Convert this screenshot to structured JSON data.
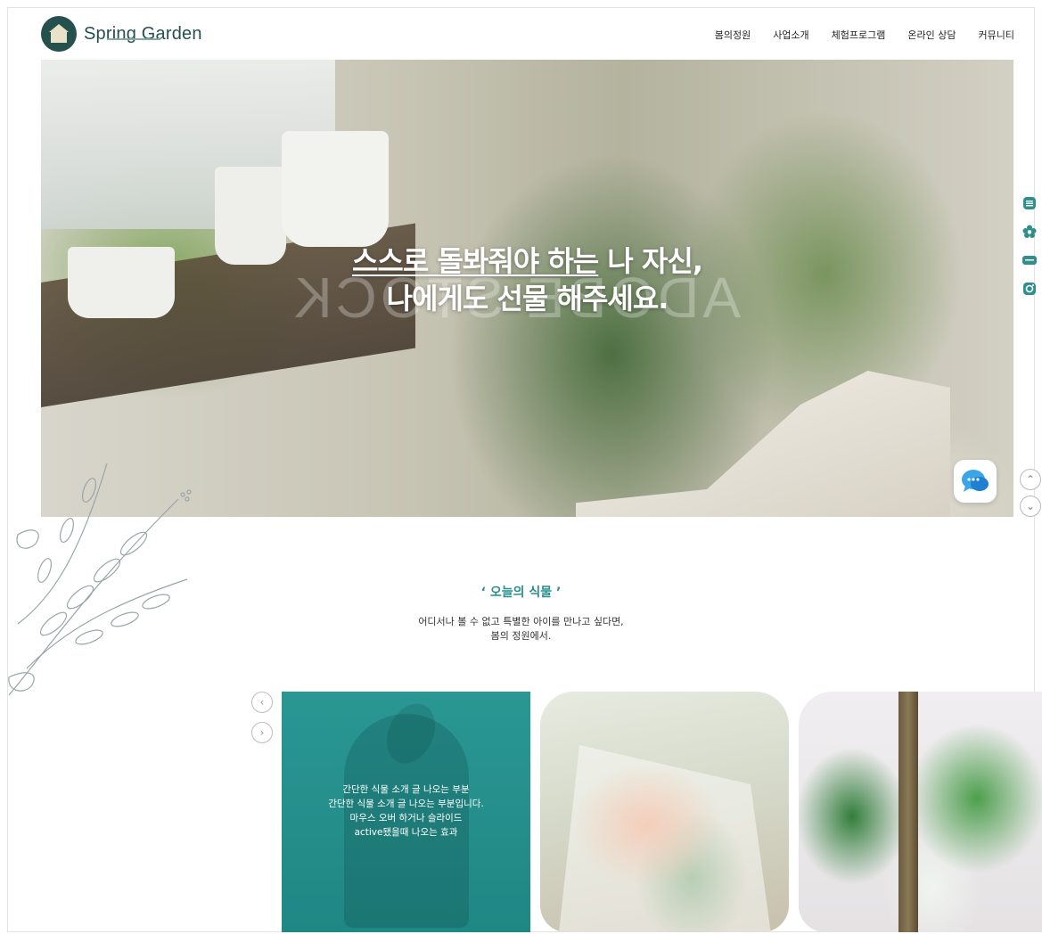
{
  "header": {
    "logo_text": "Spring Garden",
    "nav": [
      "봄의정원",
      "사업소개",
      "체험프로그램",
      "온라인 상담",
      "커뮤니티"
    ]
  },
  "hero": {
    "title_line1_underlined": "스스로 돌봐줘야 하는",
    "title_line1_rest": " 나 자신,",
    "title_line2": "나에게도 선물 해주세요.",
    "watermark": "ADOBE STOCK"
  },
  "side_icons": [
    "document-icon",
    "flower-icon",
    "blog-icon",
    "instagram-icon"
  ],
  "section": {
    "title": "‘ 오늘의 식물 ’",
    "desc_line1": "어디서나 볼 수 없고 특별한 아이를 만나고 싶다면,",
    "desc_line2": "봄의 정원에서."
  },
  "active_card": {
    "line1": "간단한 식물 소개 글 나오는 부분",
    "line2": "간단한 식물 소개 글 나오는 부분입니다.",
    "line3": "마우스 오버 하거나 슬라이드",
    "line4": "active됐을때 나오는 효과"
  },
  "colors": {
    "brand": "#24504d",
    "accent": "#2a8f8c",
    "card_active": "#24908d"
  }
}
